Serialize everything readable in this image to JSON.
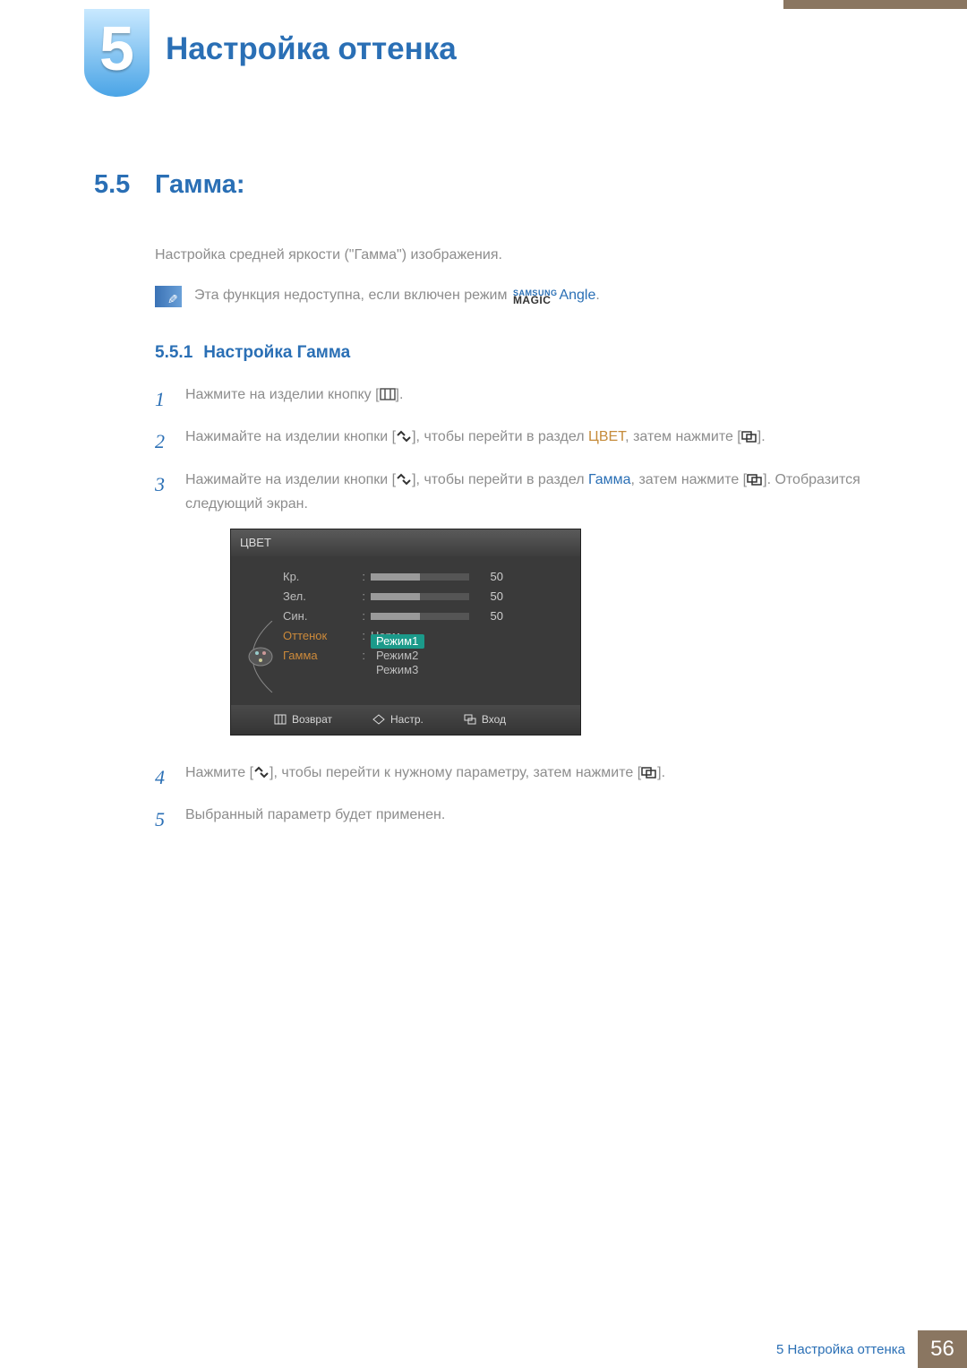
{
  "chapter": {
    "number": "5",
    "title": "Настройка оттенка"
  },
  "section": {
    "number": "5.5",
    "title": "Гамма:"
  },
  "intro": "Настройка средней яркости (\"Гамма\") изображения.",
  "note": {
    "before": "Эта функция недоступна, если включен режим ",
    "magic_top": "SAMSUNG",
    "magic_bot": "MAGIC",
    "angle": "Angle",
    "after": "."
  },
  "subsection": {
    "number": "5.5.1",
    "title": "Настройка Гамма"
  },
  "steps": {
    "s1": {
      "num": "1",
      "t1": "Нажмите на изделии кнопку [",
      "t2": "]."
    },
    "s2": {
      "num": "2",
      "t1": "Нажимайте на изделии кнопки [",
      "t2": "], чтобы перейти в раздел ",
      "hl": "ЦВЕТ",
      "t3": ", затем нажмите [",
      "t4": "]."
    },
    "s3": {
      "num": "3",
      "t1": "Нажимайте на изделии кнопки [",
      "t2": "], чтобы перейти в раздел ",
      "hl": "Гамма",
      "t3": ", затем нажмите [",
      "t4": "]. Отобразится следующий экран."
    },
    "s4": {
      "num": "4",
      "t1": "Нажмите [",
      "t2": "], чтобы перейти к нужному параметру, затем нажмите [",
      "t3": "]."
    },
    "s5": {
      "num": "5",
      "t1": "Выбранный параметр будет применен."
    }
  },
  "osd": {
    "title": "ЦВЕТ",
    "rows": {
      "r": {
        "label": "Кр.",
        "value": "50",
        "fill": 50
      },
      "g": {
        "label": "Зел.",
        "value": "50",
        "fill": 50
      },
      "b": {
        "label": "Син.",
        "value": "50",
        "fill": 50
      },
      "tint": {
        "label": "Оттенок",
        "value": "Норм."
      },
      "gamma": {
        "label": "Гамма",
        "selected": "Режим1",
        "opt2": "Режим2",
        "opt3": "Режим3"
      }
    },
    "footer": {
      "back": "Возврат",
      "adjust": "Настр.",
      "enter": "Вход"
    }
  },
  "footer": {
    "label": "5 Настройка оттенка",
    "page": "56"
  }
}
